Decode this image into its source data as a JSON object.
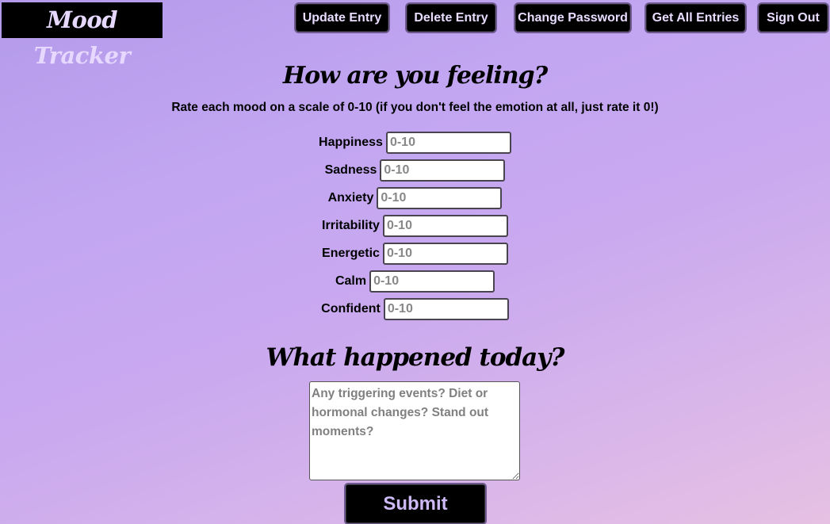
{
  "app": {
    "title": "Mood Tracker"
  },
  "nav": {
    "update_entry": "Update Entry",
    "delete_entry": "Delete Entry",
    "change_password": "Change Password",
    "get_all_entries": "Get All Entries",
    "sign_out": "Sign Out"
  },
  "form": {
    "heading": "How are you feeling?",
    "instructions": "Rate each mood on a scale of 0-10 (if you don't feel the emotion at all, just rate it 0!)",
    "moods": [
      {
        "label": "Happiness",
        "placeholder": "0-10",
        "value": ""
      },
      {
        "label": "Sadness",
        "placeholder": "0-10",
        "value": ""
      },
      {
        "label": "Anxiety",
        "placeholder": "0-10",
        "value": ""
      },
      {
        "label": "Irritability",
        "placeholder": "0-10",
        "value": ""
      },
      {
        "label": "Energetic",
        "placeholder": "0-10",
        "value": ""
      },
      {
        "label": "Calm",
        "placeholder": "0-10",
        "value": ""
      },
      {
        "label": "Confident",
        "placeholder": "0-10",
        "value": ""
      }
    ],
    "notes_heading": "What happened today?",
    "notes_placeholder": "Any triggering events? Diet or hormonal changes? Stand out moments?",
    "notes_value": "",
    "submit_label": "Submit"
  },
  "colors": {
    "background_top": "#b39ae9",
    "background_bottom": "#e6c1e3",
    "button_bg": "#000000",
    "button_text": "#e8dcff"
  }
}
